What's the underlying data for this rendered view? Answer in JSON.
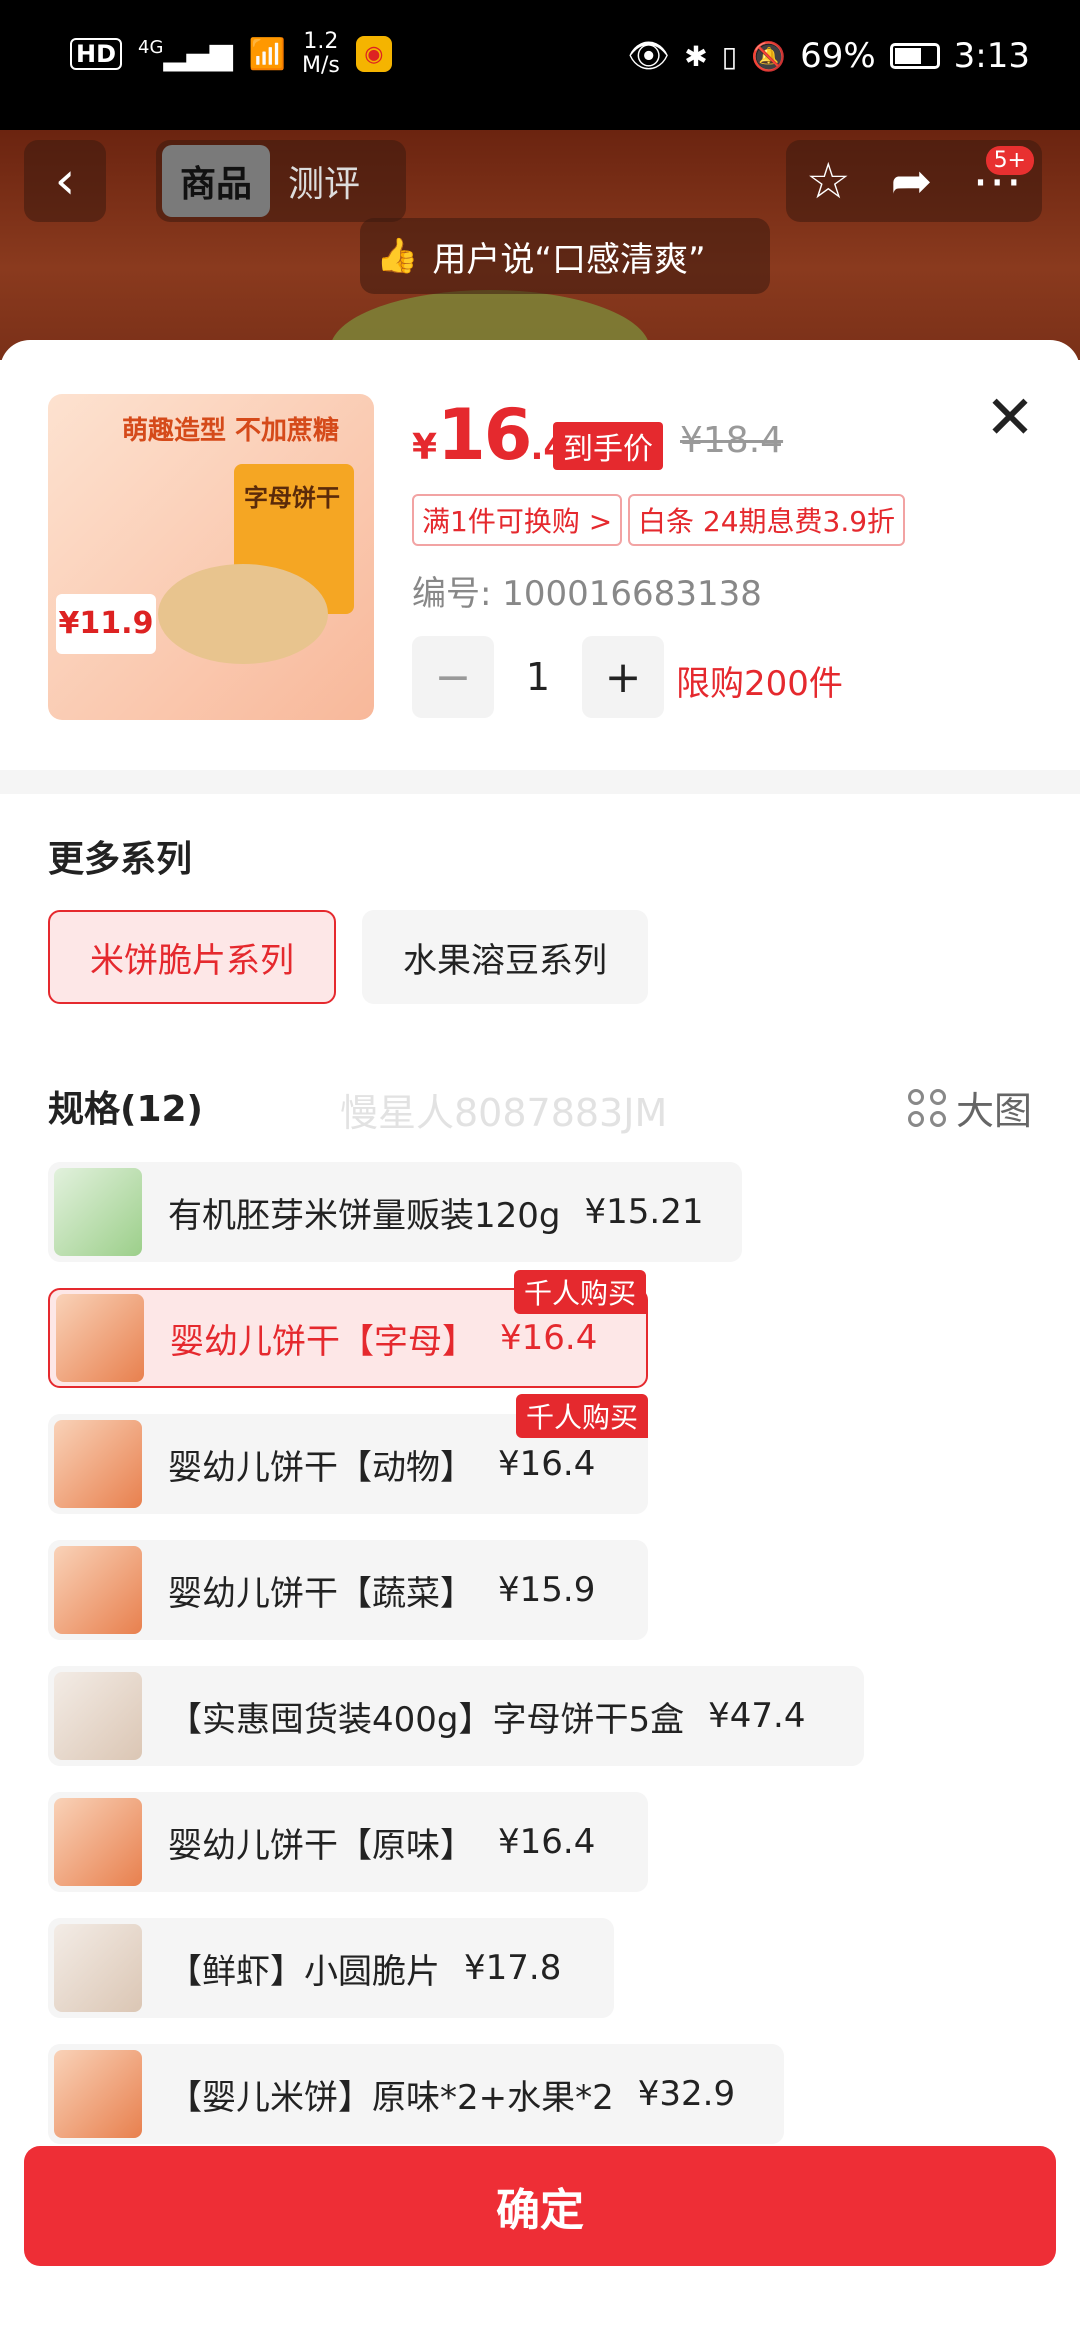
{
  "status_bar": {
    "hd": "HD",
    "network": "4G",
    "speed_value": "1.2",
    "speed_unit": "M/s",
    "battery": "69%",
    "time": "3:13"
  },
  "header": {
    "tab_active": "商品",
    "tab_inactive": "测评",
    "badge": "5+",
    "user_says": "用户说“口感清爽”"
  },
  "product": {
    "image_tag": "萌趣造型 不加蔗糖",
    "image_box_text": "字母饼干",
    "image_price": "¥11.9",
    "price_symbol": "¥",
    "price_int": "16",
    "price_dec": ".4",
    "hand_price_tag": "到手价",
    "original_price": "¥18.4",
    "promo_1": "满1件可换购 >",
    "promo_2": "白条 24期息费3.9折",
    "sku": "编号: 100016683138",
    "quantity": "1",
    "limit": "限购200件"
  },
  "series_section": {
    "title": "更多系列",
    "options": [
      "米饼脆片系列",
      "水果溶豆系列"
    ],
    "selected": 0
  },
  "spec_section": {
    "title": "规格(12)",
    "watermark": "慢星人8087883JM",
    "big_view": "大图",
    "hot_label": "千人购买",
    "items": [
      {
        "name": "有机胚芽米饼量贩装120g",
        "price": "¥15.21"
      },
      {
        "name": "婴幼儿饼干【字母】",
        "price": "¥16.4"
      },
      {
        "name": "婴幼儿饼干【动物】",
        "price": "¥16.4"
      },
      {
        "name": "婴幼儿饼干【蔬菜】",
        "price": "¥15.9"
      },
      {
        "name": "【实惠囤货装400g】字母饼干5盒",
        "price": "¥47.4"
      },
      {
        "name": "婴幼儿饼干【原味】",
        "price": "¥16.4"
      },
      {
        "name": "【鲜虾】小圆脆片",
        "price": "¥17.8"
      },
      {
        "name": "【婴儿米饼】原味*2+水果*2",
        "price": "¥32.9"
      }
    ]
  },
  "confirm_label": "确定",
  "colors": {
    "accent": "#e5292e",
    "confirm": "#ee2e36"
  }
}
